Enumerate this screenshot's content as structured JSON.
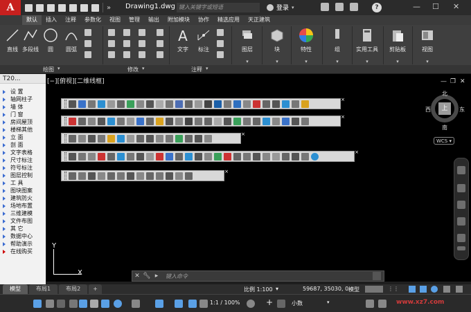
{
  "app": {
    "logo": "A",
    "title": "Drawing1.dwg",
    "search_placeholder": "键入关键字或短语",
    "login_label": "登录",
    "help": "?"
  },
  "ribbon_tabs": [
    "默认",
    "插入",
    "注释",
    "参数化",
    "视图",
    "管理",
    "输出",
    "附加模块",
    "协作",
    "精选应用",
    "天正建筑"
  ],
  "draw_group": {
    "label": "绘图",
    "tools": [
      "直线",
      "多段线",
      "圆",
      "圆弧"
    ]
  },
  "modify_group": {
    "label": "修改"
  },
  "annotation_group": {
    "label": "注释",
    "tools": [
      "文字",
      "标注"
    ]
  },
  "big_tools": [
    "图层",
    "块",
    "特性",
    "组",
    "实用工具",
    "剪贴板",
    "视图"
  ],
  "viewport_label": "[−][俯视][二维线框]",
  "left_panel": {
    "header": "T20...",
    "items": [
      "设 置",
      "轴网柱子",
      "墙 体",
      "门 窗",
      "房间屋顶",
      "楼梯其他",
      "立 面",
      "剖 面",
      "文字表格",
      "尺寸标注",
      "符号标注",
      "图层控制",
      "工 具",
      "图块图案",
      "建筑防火",
      "场地布置",
      "三维建模",
      "文件布图",
      "其 它",
      "数据中心",
      "帮助演示",
      "在线购买"
    ]
  },
  "viewcube": {
    "top_face": "上",
    "north": "北",
    "south": "南",
    "east": "东",
    "west": "西",
    "wcs": "WCS"
  },
  "ucs": {
    "x": "X",
    "y": "Y"
  },
  "command": {
    "prompt": "键入命令"
  },
  "layout_tabs": [
    "模型",
    "布局1",
    "布局2",
    "+"
  ],
  "status": {
    "scale": "比例 1:100",
    "coords": "59687, 35030, 0",
    "model": "模型",
    "zoom": "1:1 / 100%",
    "units": "小数"
  },
  "watermark": "www.xz7.com"
}
